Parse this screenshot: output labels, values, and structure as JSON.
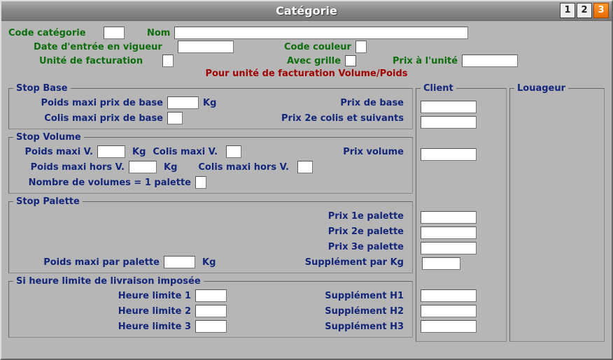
{
  "window": {
    "title": "Catégorie"
  },
  "tabs": [
    "1",
    "2",
    "3"
  ],
  "header": {
    "code_categorie": "Code catégorie",
    "nom": "Nom",
    "date_entree": "Date d'entrée en vigueur",
    "code_couleur": "Code couleur",
    "unite_fact": "Unité de facturation",
    "avec_grille": "Avec grille",
    "prix_unite": "Prix à l'unité",
    "subheading": "Pour unité de facturation Volume/Poids"
  },
  "stop_base": {
    "legend": "Stop Base",
    "poids_maxi": "Poids maxi prix de base",
    "kg": "Kg",
    "prix_de_base": "Prix de base",
    "colis_maxi": "Colis maxi prix de base",
    "prix_2e_colis": "Prix 2e colis et suivants"
  },
  "stop_volume": {
    "legend": "Stop Volume",
    "poids_maxi_v": "Poids maxi V.",
    "kg": "Kg",
    "colis_maxi_v": "Colis maxi V.",
    "prix_volume": "Prix volume",
    "poids_maxi_hors_v": "Poids maxi hors V.",
    "colis_maxi_hors_v": "Colis maxi hors V.",
    "nb_volumes_palette": "Nombre de volumes = 1 palette"
  },
  "stop_palette": {
    "legend": "Stop Palette",
    "prix_1e": "Prix 1e palette",
    "prix_2e": "Prix 2e palette",
    "prix_3e": "Prix 3e palette",
    "poids_maxi_par_palette": "Poids maxi par palette",
    "kg": "Kg",
    "supp_kg": "Supplément par Kg"
  },
  "heure": {
    "legend": "Si heure limite de livraison imposée",
    "h1": "Heure limite 1",
    "h2": "Heure limite 2",
    "h3": "Heure limite 3",
    "s1": "Supplément H1",
    "s2": "Supplément H2",
    "s3": "Supplément H3"
  },
  "columns": {
    "client": "Client",
    "louageur": "Louageur"
  }
}
